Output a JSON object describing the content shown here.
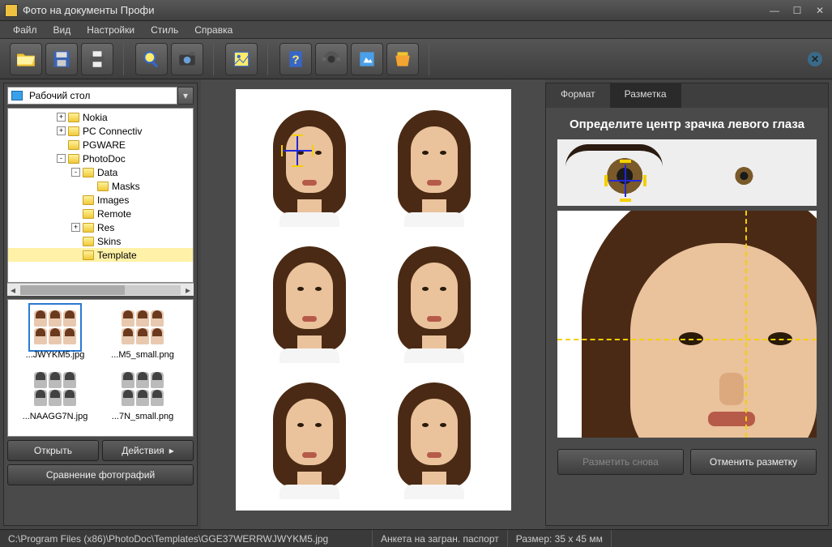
{
  "title": "Фото на документы Профи",
  "menu": [
    "Файл",
    "Вид",
    "Настройки",
    "Стиль",
    "Справка"
  ],
  "toolbar_icons": [
    "open",
    "save",
    "print",
    "zoom",
    "camera",
    "crop",
    "help",
    "clothes",
    "retouch",
    "export"
  ],
  "path_combo": "Рабочий стол",
  "tree": [
    {
      "indent": 60,
      "exp": "+",
      "label": "Nokia"
    },
    {
      "indent": 60,
      "exp": "+",
      "label": "PC Connectiv"
    },
    {
      "indent": 60,
      "exp": "",
      "label": "PGWARE"
    },
    {
      "indent": 60,
      "exp": "-",
      "label": "PhotoDoc"
    },
    {
      "indent": 78,
      "exp": "-",
      "label": "Data"
    },
    {
      "indent": 96,
      "exp": "",
      "label": "Masks"
    },
    {
      "indent": 78,
      "exp": "",
      "label": "Images"
    },
    {
      "indent": 78,
      "exp": "",
      "label": "Remote"
    },
    {
      "indent": 78,
      "exp": "+",
      "label": "Res"
    },
    {
      "indent": 78,
      "exp": "",
      "label": "Skins"
    },
    {
      "indent": 78,
      "exp": "",
      "label": "Template",
      "sel": true
    }
  ],
  "thumbs": [
    {
      "label": "...JWYKM5.jpg",
      "sel": true,
      "gray": false
    },
    {
      "label": "...M5_small.png",
      "gray": false
    },
    {
      "label": "...NAAGG7N.jpg",
      "gray": true
    },
    {
      "label": "...7N_small.png",
      "gray": true
    }
  ],
  "left_buttons": {
    "open": "Открыть",
    "actions": "Действия",
    "compare": "Сравнение фотографий"
  },
  "tabs": {
    "format": "Формат",
    "markup": "Разметка"
  },
  "active_tab": "markup",
  "instruction": "Определите центр зрачка левого глаза",
  "right_buttons": {
    "remark": "Разметить снова",
    "cancel": "Отменить разметку"
  },
  "status": {
    "path": "C:\\Program Files (x86)\\PhotoDoc\\Templates\\GGE37WERRWJWYKM5.jpg",
    "format": "Анкета на загран. паспорт",
    "size": "Размер: 35 x 45 мм"
  }
}
